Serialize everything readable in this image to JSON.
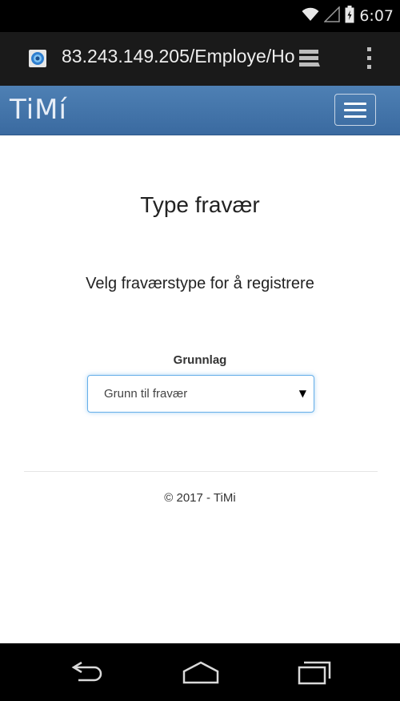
{
  "status_bar": {
    "time": "6:07",
    "icons": [
      "wifi-icon",
      "signal-icon",
      "battery-icon"
    ]
  },
  "browser": {
    "url": "83.243.149.205/Employe/Ho",
    "icons": [
      "favicon-icon",
      "tabs-icon",
      "overflow-menu-icon"
    ]
  },
  "header": {
    "brand": "TiMí",
    "menu_icon": "hamburger-icon"
  },
  "main": {
    "title": "Type fravær",
    "subtitle": "Velg fraværstype for å registrere",
    "field_label": "Grunnlag",
    "select_value": "Grunn til fravær",
    "select_arrow": "▼"
  },
  "footer": {
    "text": "© 2017 - TiMi"
  },
  "nav_bar": {
    "icons": [
      "back-icon",
      "home-icon",
      "recents-icon"
    ]
  }
}
